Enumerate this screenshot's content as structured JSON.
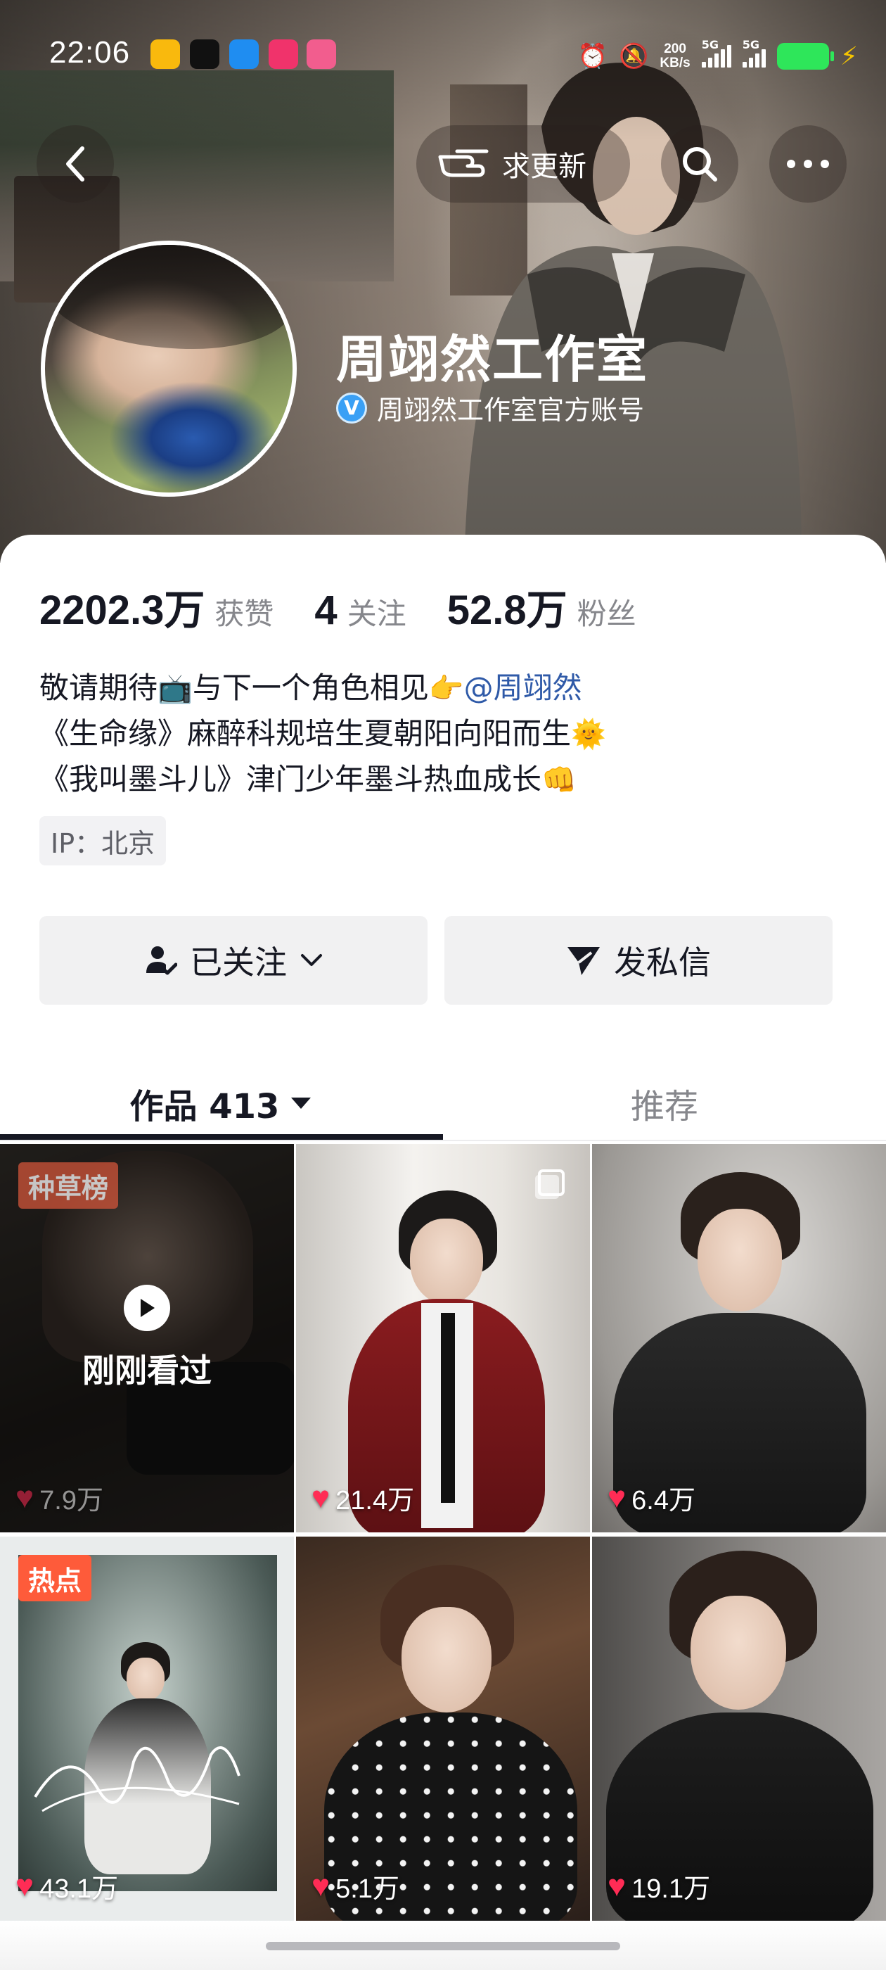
{
  "status_bar": {
    "time": "22:06",
    "net_speed_value": "200",
    "net_speed_unit": "KB/s",
    "signal_1_label": "5G",
    "signal_2_label": "5G",
    "app_icons": [
      "weibo-icon",
      "tiktok-icon",
      "browser-icon",
      "music-icon",
      "bilibili-icon"
    ],
    "right_icons": [
      "alarm-icon",
      "mute-icon",
      "battery-icon",
      "charging-icon"
    ]
  },
  "header": {
    "back_icon": "chevron-left-icon",
    "request_update_label": "求更新",
    "search_icon": "search-icon",
    "more_icon": "more-icon"
  },
  "profile": {
    "name": "周翊然工作室",
    "verified_label": "周翊然工作室官方账号",
    "verified_badge": "V"
  },
  "stats": [
    {
      "value": "2202.3万",
      "label": "获赞"
    },
    {
      "value": "4",
      "label": "关注"
    },
    {
      "value": "52.8万",
      "label": "粉丝"
    }
  ],
  "bio": {
    "line1_text": "敬请期待",
    "line1_emoji": "📺",
    "line1_text2": "与下一个角色相见",
    "line1_emoji2": "👉",
    "line1_mention": "@周翊然",
    "line2_text": "《生命缘》麻醉科规培生夏朝阳向阳而生",
    "line2_emoji": "🌞",
    "line3_text": "《我叫墨斗儿》津门少年墨斗热血成长",
    "line3_emoji": "👊"
  },
  "ip_label": "IP：北京",
  "actions": {
    "follow_label": "已关注",
    "message_label": "发私信"
  },
  "tabs": {
    "works_label": "作品 413",
    "recommend_label": "推荐"
  },
  "videos": [
    {
      "likes": "7.9万",
      "badge": "种草榜",
      "overlay": "刚刚看过"
    },
    {
      "likes": "21.4万"
    },
    {
      "likes": "6.4万"
    },
    {
      "likes": "43.1万",
      "badge": "热点"
    },
    {
      "likes": "5.1万"
    },
    {
      "likes": "19.1万"
    }
  ],
  "colors": {
    "like_heart": "#ff2c55",
    "mention": "#2f5aa8",
    "hot_badge": "#fe5b3a",
    "ranking_badge": "#d2553a",
    "verified": "#3aa0f5",
    "battery": "#2ee65a"
  }
}
